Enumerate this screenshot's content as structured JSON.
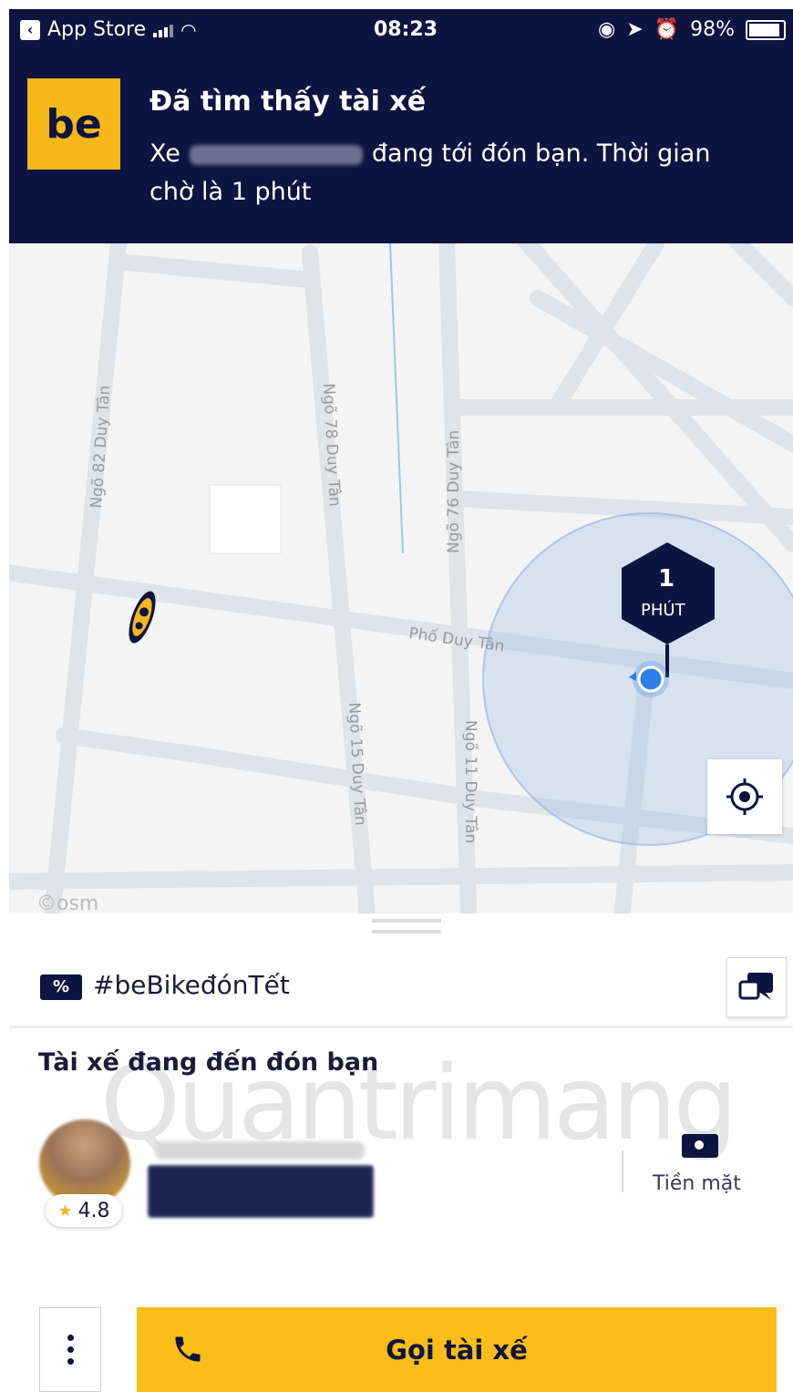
{
  "status_bar": {
    "back_app": "App Store",
    "time": "08:23",
    "battery": "98%"
  },
  "notification": {
    "logo": "be",
    "title": "Đã tìm thấy tài xế",
    "body_prefix": "Xe",
    "body_suffix": "đang tới đón bạn. Thời gian chờ là 1 phút"
  },
  "map": {
    "streets": {
      "ngo82": "Ngõ 82 Duy Tân",
      "ngo78": "Ngõ 78 Duy Tân",
      "ngo76": "Ngõ 76 Duy Tân",
      "pho": "Phố Duy Tân",
      "ngo15": "Ngõ 15 Duy Tân",
      "ngo11": "Ngõ 11 Duy Tân"
    },
    "eta": {
      "value": "1",
      "unit": "PHÚT"
    },
    "attribution": "©osm"
  },
  "sheet": {
    "promo": "#beBikeđónTết",
    "promo_icon": "%",
    "driver_status": "Tài xế đang đến đón bạn",
    "rating": "4.8",
    "payment": "Tiền mặt",
    "call_button": "Gọi tài xế",
    "watermark": "Quantrimang"
  },
  "colors": {
    "navy": "#0d1440",
    "brand_yellow": "#fbbd1a",
    "map_bg": "#f4f4f4",
    "road": "#dde4ea",
    "user_dot": "#2f7ee6"
  }
}
